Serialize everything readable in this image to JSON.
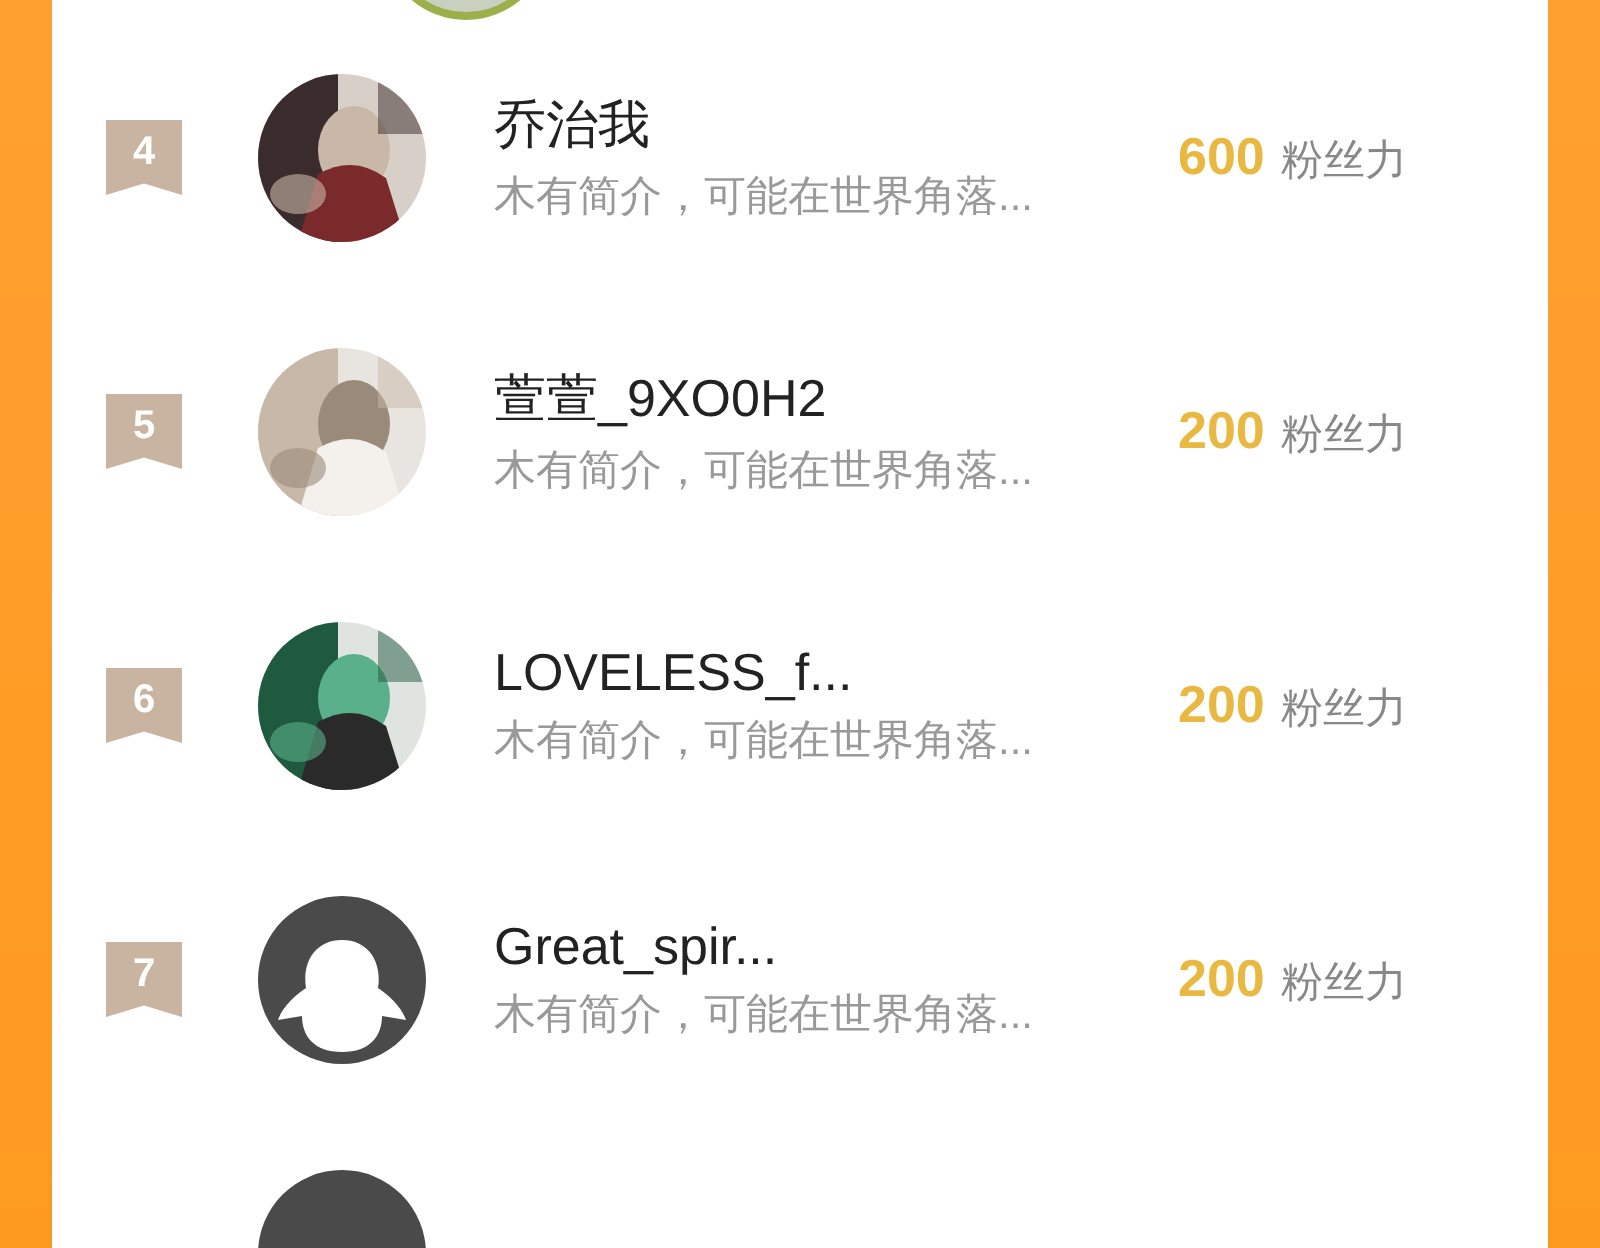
{
  "rows": [
    {
      "rank": "4",
      "name": "乔治我",
      "bio": "木有简介，可能在世界角落...",
      "score": "600",
      "score_label": "粉丝力"
    },
    {
      "rank": "5",
      "name": "萱萱_9XO0H2",
      "bio": "木有简介，可能在世界角落...",
      "score": "200",
      "score_label": "粉丝力"
    },
    {
      "rank": "6",
      "name": "LOVELESS_f...",
      "bio": "木有简介，可能在世界角落...",
      "score": "200",
      "score_label": "粉丝力"
    },
    {
      "rank": "7",
      "name": "Great_spir...",
      "bio": "木有简介，可能在世界角落...",
      "score": "200",
      "score_label": "粉丝力",
      "avatar": {
        "kind": "default"
      }
    }
  ],
  "bottom_avatar": {
    "kind": "default"
  }
}
